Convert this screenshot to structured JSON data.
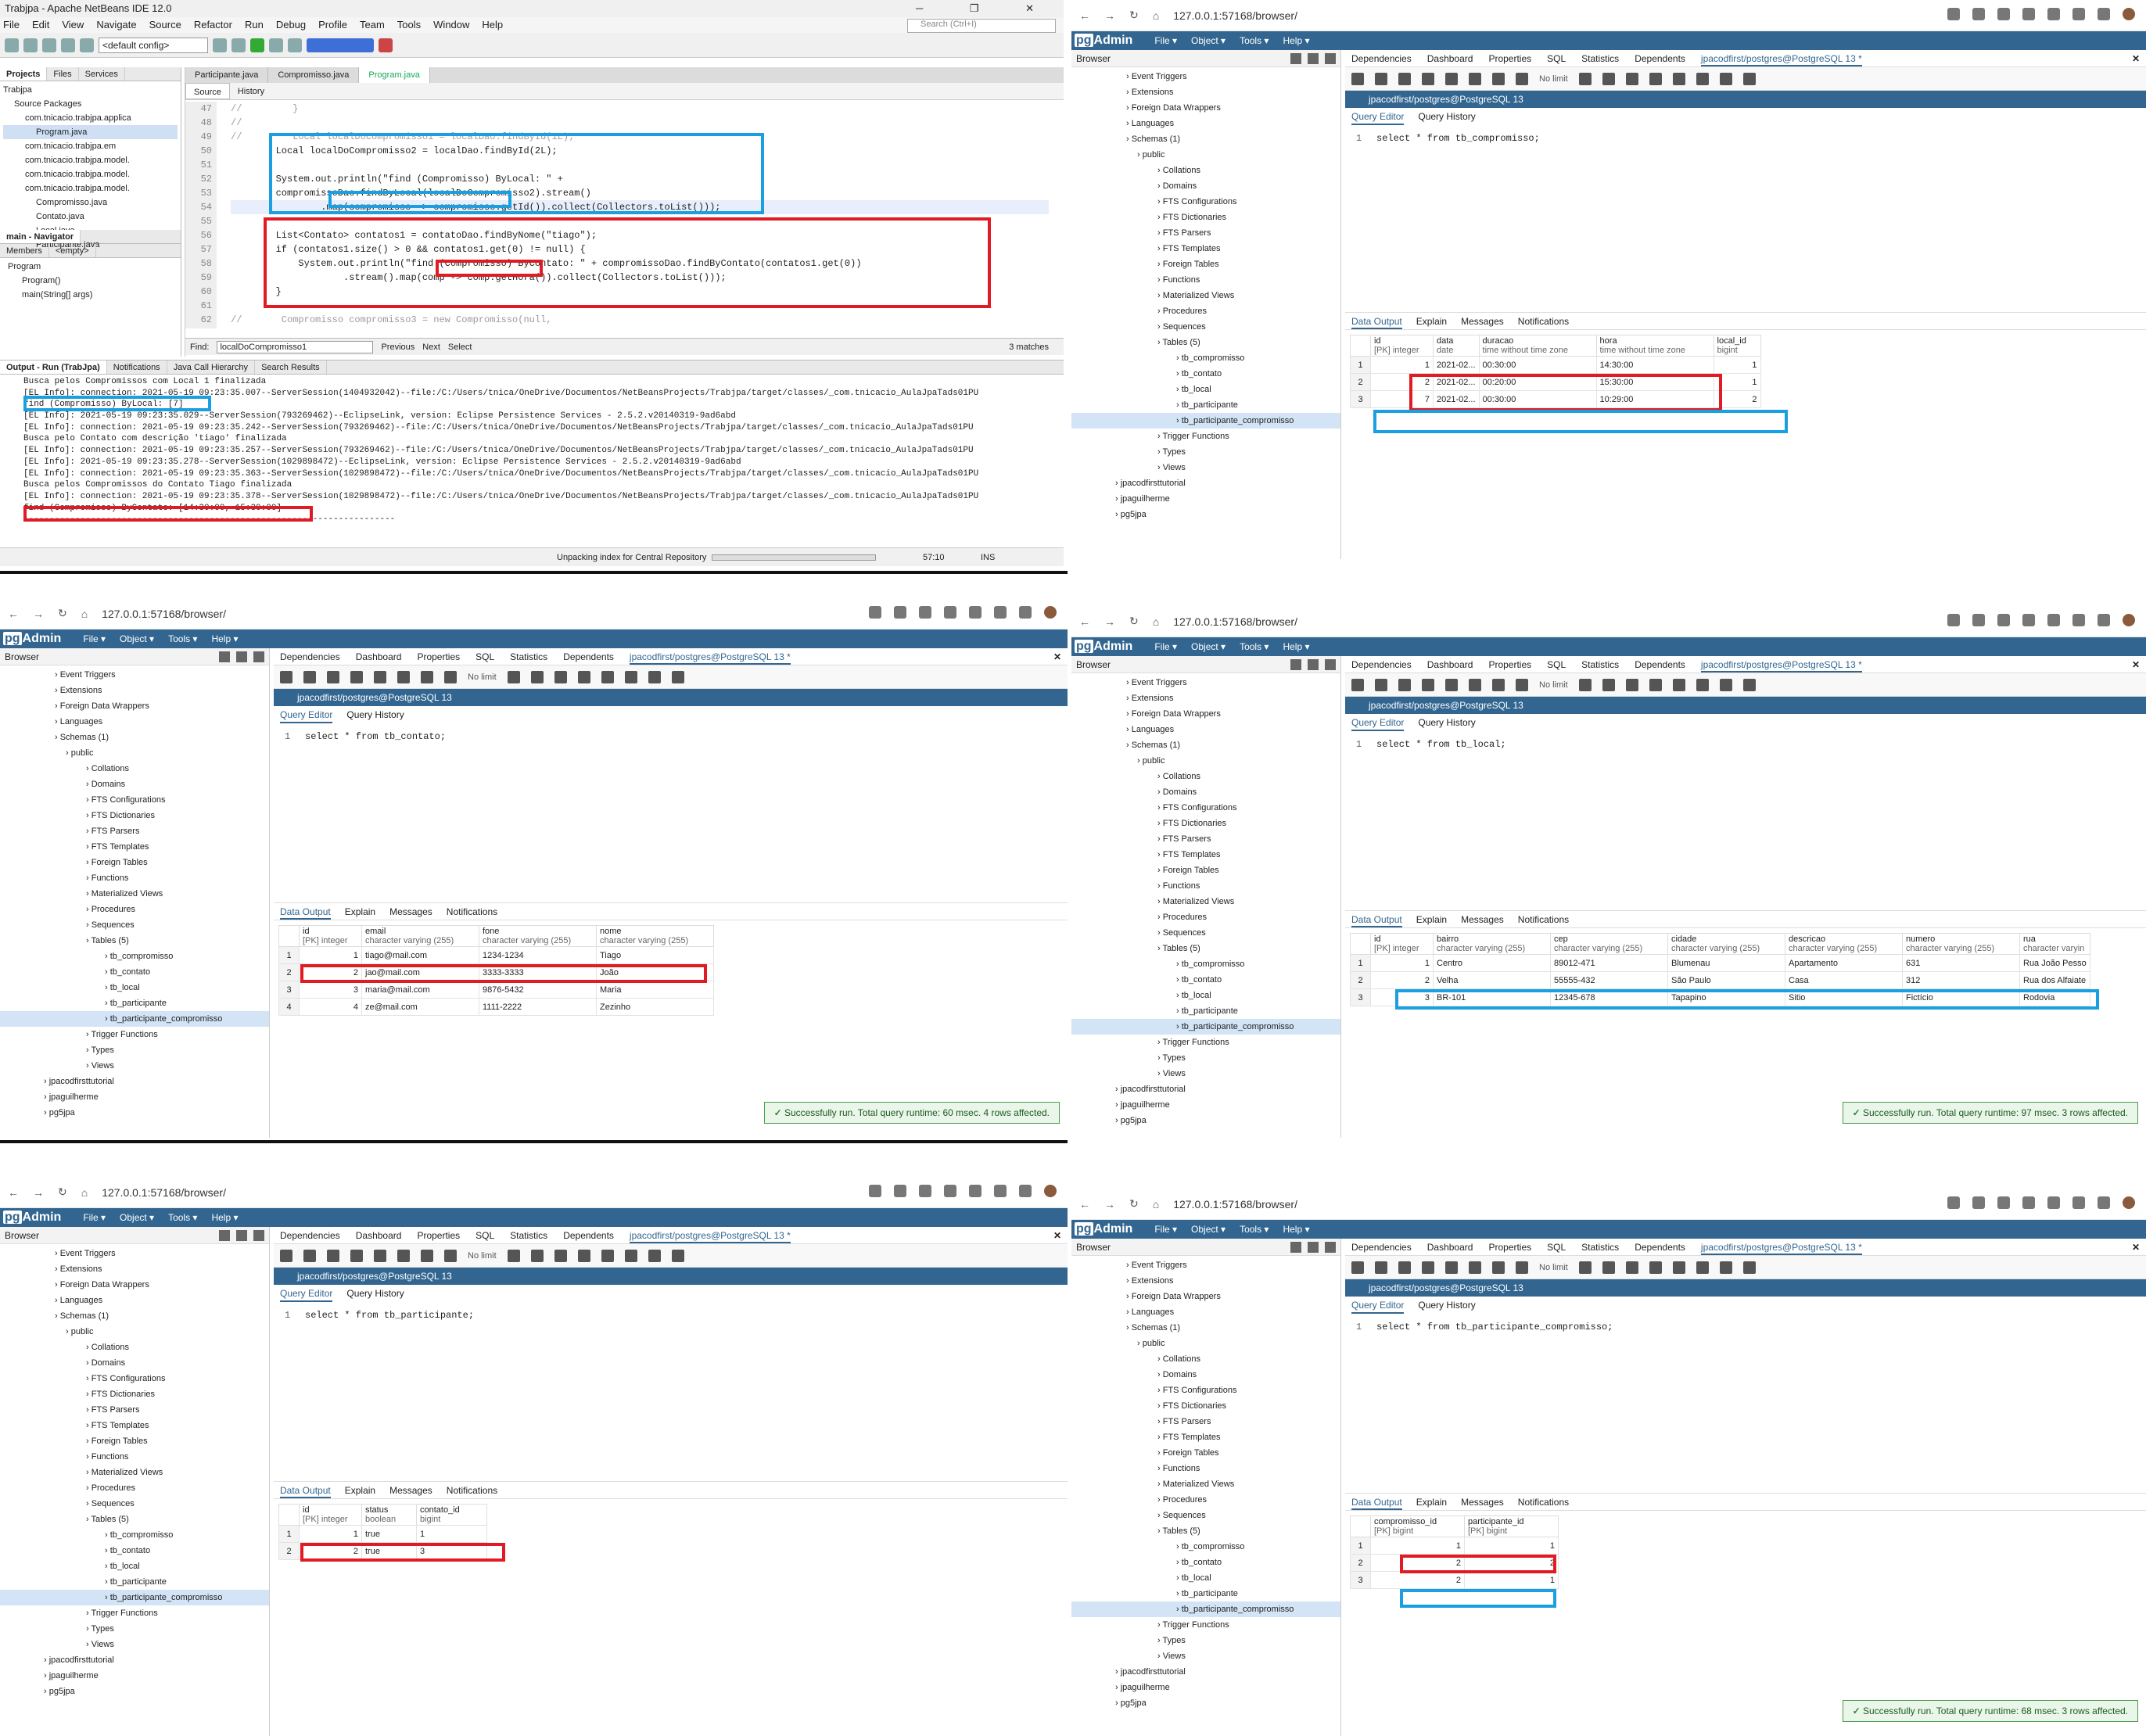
{
  "netbeans": {
    "title": "Trabjpa - Apache NetBeans IDE 12.0",
    "menu": [
      "File",
      "Edit",
      "View",
      "Navigate",
      "Source",
      "Refactor",
      "Run",
      "Debug",
      "Profile",
      "Team",
      "Tools",
      "Window",
      "Help"
    ],
    "search_placeholder": "Search (Ctrl+I)",
    "config": "<default config>",
    "left_tabs": [
      "Projects",
      "Files",
      "Services"
    ],
    "project_tree": [
      "Trabjpa",
      "Source Packages",
      "com.tnicacio.trabjpa.applica",
      "Program.java",
      "com.tnicacio.trabjpa.em",
      "com.tnicacio.trabjpa.model.",
      "com.tnicacio.trabjpa.model.",
      "com.tnicacio.trabjpa.model.",
      "Compromisso.java",
      "Contato.java",
      "Local.java",
      "Participante.java"
    ],
    "navigator_title": "main - Navigator",
    "navigator_tabs": [
      "Members",
      "<empty>"
    ],
    "navigator_tree": [
      "Program",
      "Program()",
      "main(String[] args)"
    ],
    "editor_tabs": [
      "Participante.java",
      "Compromisso.java",
      "Program.java"
    ],
    "editor_views": [
      "Source",
      "History"
    ],
    "line_numbers": [
      "47",
      "48",
      "49",
      "50",
      "51",
      "52",
      "53",
      "54",
      "55",
      "56",
      "57",
      "58",
      "59",
      "60",
      "61",
      "62"
    ],
    "code_lines": [
      "//         }",
      "//",
      "//         Local localDoCompromisso1 = localDao.findById(1L);",
      "        Local localDoCompromisso2 = localDao.findById(2L);",
      "",
      "        System.out.println(\"find (Compromisso) ByLocal: \" +",
      "        compromissoDao.findByLocal(localDoCompromisso2).stream()",
      "                .map(compromisso -> compromisso.getId()).collect(Collectors.toList()));",
      "",
      "        List<Contato> contatos1 = contatoDao.findByNome(\"tiago\");",
      "        if (contatos1.size() > 0 && contatos1.get(0) != null) {",
      "            System.out.println(\"find (Compromisso) ByContato: \" + compromissoDao.findByContato(contatos1.get(0))",
      "                    .stream().map(comp -> comp.getHora()).collect(Collectors.toList()));",
      "        }",
      "",
      "//       Compromisso compromisso3 = new Compromisso(null,"
    ],
    "find": {
      "label": "Find:",
      "value": "localDoCompromisso1",
      "previous": "Previous",
      "next": "Next",
      "select": "Select",
      "matches": "3 matches"
    },
    "output_tabs": [
      "Output - Run (TrabJpa)",
      "Notifications",
      "Java Call Hierarchy",
      "Search Results"
    ],
    "output_lines": [
      "Busca pelos Compromissos com Local 1 finalizada",
      "[EL Info]: connection: 2021-05-19 09:23:35.007--ServerSession(1404932042)--file:/C:/Users/tnica/OneDrive/Documentos/NetBeansProjects/Trabjpa/target/classes/_com.tnicacio_AulaJpaTads01PU",
      "find (Compromisso) ByLocal: [7]",
      "[EL Info]: 2021-05-19 09:23:35.029--ServerSession(793269462)--EclipseLink, version: Eclipse Persistence Services - 2.5.2.v20140319-9ad6abd",
      "[EL Info]: connection: 2021-05-19 09:23:35.242--ServerSession(793269462)--file:/C:/Users/tnica/OneDrive/Documentos/NetBeansProjects/Trabjpa/target/classes/_com.tnicacio_AulaJpaTads01PU",
      "Busca pelo Contato com descrição 'tiago' finalizada",
      "[EL Info]: connection: 2021-05-19 09:23:35.257--ServerSession(793269462)--file:/C:/Users/tnica/OneDrive/Documentos/NetBeansProjects/Trabjpa/target/classes/_com.tnicacio_AulaJpaTads01PU",
      "[EL Info]: 2021-05-19 09:23:35.278--ServerSession(1029898472)--EclipseLink, version: Eclipse Persistence Services - 2.5.2.v20140319-9ad6abd",
      "[EL Info]: connection: 2021-05-19 09:23:35.363--ServerSession(1029898472)--file:/C:/Users/tnica/OneDrive/Documentos/NetBeansProjects/Trabjpa/target/classes/_com.tnicacio_AulaJpaTads01PU",
      "Busca pelos Compromissos do Contato Tiago finalizada",
      "[EL Info]: connection: 2021-05-19 09:23:35.378--ServerSession(1029898472)--file:/C:/Users/tnica/OneDrive/Documentos/NetBeansProjects/Trabjpa/target/classes/_com.tnicacio_AulaJpaTads01PU",
      "find (Compromisso) ByContato: [14:30:00, 15:30:00]",
      "------------------------------------------------------------------------"
    ],
    "status": {
      "task": "Unpacking index for Central Repository",
      "position": "57:10",
      "mode": "INS"
    }
  },
  "pgadmin_common": {
    "url": "127.0.0.1:57168/browser/",
    "menus": [
      "File",
      "Object",
      "Tools",
      "Help"
    ],
    "browser_label": "Browser",
    "tabs": [
      "Dependencies",
      "Dashboard",
      "Properties",
      "SQL",
      "Statistics",
      "Dependents",
      "jpacodfirst/postgres@PostgreSQL 13 *"
    ],
    "connection": "jpacodfirst/postgres@PostgreSQL 13",
    "no_limit": "No limit",
    "editor_tabs": [
      "Query Editor",
      "Query History"
    ],
    "output_tabs": [
      "Data Output",
      "Explain",
      "Messages",
      "Notifications"
    ],
    "tree": [
      "Event Triggers",
      "Extensions",
      "Foreign Data Wrappers",
      "Languages",
      "Schemas (1)",
      "public",
      "Collations",
      "Domains",
      "FTS Configurations",
      "FTS Dictionaries",
      "FTS Parsers",
      "FTS Templates",
      "Foreign Tables",
      "Functions",
      "Materialized Views",
      "Procedures",
      "Sequences",
      "Tables (5)",
      "tb_compromisso",
      "tb_contato",
      "tb_local",
      "tb_participante",
      "tb_participante_compromisso",
      "Trigger Functions",
      "Types",
      "Views",
      "jpacodfirsttutorial",
      "jpaguilherme",
      "pg5jpa"
    ]
  },
  "q_compromisso": {
    "sql": "select * from tb_compromisso;",
    "columns": [
      [
        "id",
        "[PK] integer"
      ],
      [
        "data",
        "date"
      ],
      [
        "duracao",
        "time without time zone"
      ],
      [
        "hora",
        "time without time zone"
      ],
      [
        "local_id",
        "bigint"
      ]
    ],
    "rows": [
      [
        "1",
        "2021-02...",
        "00:30:00",
        "14:30:00",
        "1"
      ],
      [
        "2",
        "2021-02...",
        "00:20:00",
        "15:30:00",
        "1"
      ],
      [
        "7",
        "2021-02...",
        "00:30:00",
        "10:29:00",
        "2"
      ]
    ]
  },
  "q_contato": {
    "sql": "select * from tb_contato;",
    "columns": [
      [
        "id",
        "[PK] integer"
      ],
      [
        "email",
        "character varying (255)"
      ],
      [
        "fone",
        "character varying (255)"
      ],
      [
        "nome",
        "character varying (255)"
      ]
    ],
    "rows": [
      [
        "1",
        "tiago@mail.com",
        "1234-1234",
        "Tiago"
      ],
      [
        "2",
        "jao@mail.com",
        "3333-3333",
        "João"
      ],
      [
        "3",
        "maria@mail.com",
        "9876-5432",
        "Maria"
      ],
      [
        "4",
        "ze@mail.com",
        "1111-2222",
        "Zezinho"
      ]
    ],
    "toast": "Successfully run. Total query runtime: 60 msec. 4 rows affected."
  },
  "q_local": {
    "sql": "select * from tb_local;",
    "columns": [
      [
        "id",
        "[PK] integer"
      ],
      [
        "bairro",
        "character varying (255)"
      ],
      [
        "cep",
        "character varying (255)"
      ],
      [
        "cidade",
        "character varying (255)"
      ],
      [
        "descricao",
        "character varying (255)"
      ],
      [
        "numero",
        "character varying (255)"
      ],
      [
        "rua",
        "character varyin"
      ]
    ],
    "rows": [
      [
        "1",
        "Centro",
        "89012-471",
        "Blumenau",
        "Apartamento",
        "631",
        "Rua João Pesso"
      ],
      [
        "2",
        "Velha",
        "55555-432",
        "São Paulo",
        "Casa",
        "312",
        "Rua dos Alfaiate"
      ],
      [
        "3",
        "BR-101",
        "12345-678",
        "Tapapino",
        "Sitio",
        "Fictício",
        "Rodovia"
      ]
    ],
    "toast": "Successfully run. Total query runtime: 97 msec. 3 rows affected."
  },
  "q_participante": {
    "sql": "select * from tb_participante;",
    "columns": [
      [
        "id",
        "[PK] integer"
      ],
      [
        "status",
        "boolean"
      ],
      [
        "contato_id",
        "bigint"
      ]
    ],
    "rows": [
      [
        "1",
        "true",
        "1"
      ],
      [
        "2",
        "true",
        "3"
      ]
    ]
  },
  "q_part_comp": {
    "sql": "select * from tb_participante_compromisso;",
    "columns": [
      [
        "compromisso_id",
        "[PK] bigint"
      ],
      [
        "participante_id",
        "[PK] bigint"
      ]
    ],
    "rows": [
      [
        "1",
        "1"
      ],
      [
        "2",
        "2"
      ],
      [
        "2",
        "1"
      ]
    ],
    "toast": "Successfully run. Total query runtime: 68 msec. 3 rows affected."
  }
}
